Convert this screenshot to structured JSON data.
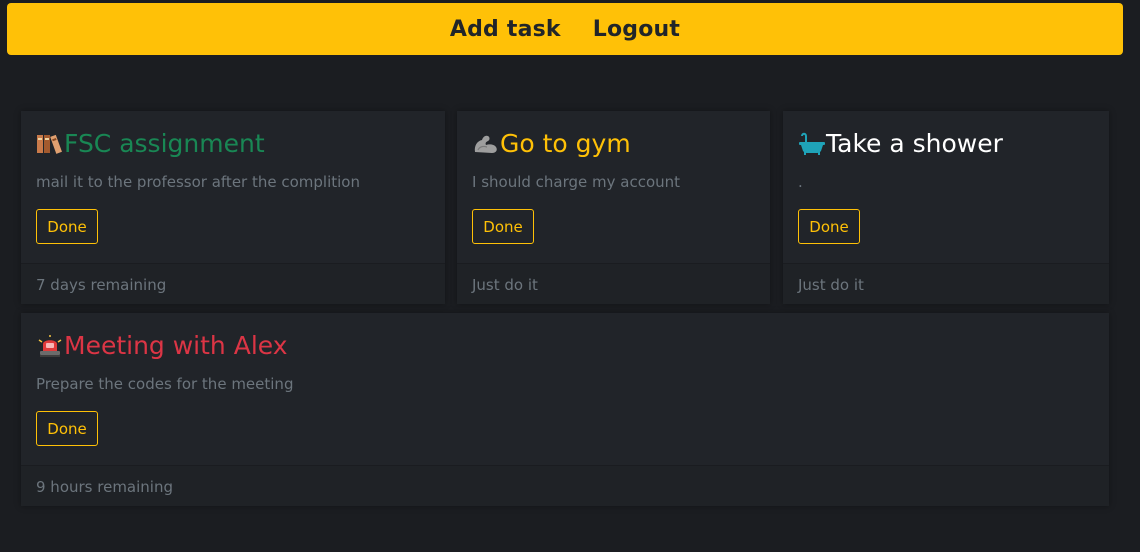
{
  "nav": {
    "add_task": "Add task",
    "logout": "Logout"
  },
  "colors": {
    "navbar": "#ffc107",
    "success": "#198754",
    "warning": "#ffc107",
    "light": "#ffffff",
    "danger": "#dc3545",
    "muted": "#6c757d",
    "background": "#1b1d21"
  },
  "tasks": [
    {
      "icon": "books-icon",
      "title": "FSC assignment",
      "description": "mail it to the professor after the complition",
      "button_label": "Done",
      "footer": "7 days remaining",
      "title_color": "#198754"
    },
    {
      "icon": "flexed-biceps-icon",
      "title": "Go to gym",
      "description": "I should charge my account",
      "button_label": "Done",
      "footer": "Just do it",
      "title_color": "#ffc107"
    },
    {
      "icon": "bathtub-icon",
      "title": "Take a shower",
      "description": ".",
      "button_label": "Done",
      "footer": "Just do it",
      "title_color": "#ffffff"
    },
    {
      "icon": "police-light-icon",
      "title": "Meeting with Alex",
      "description": "Prepare the codes for the meeting",
      "button_label": "Done",
      "footer": "9 hours remaining",
      "title_color": "#dc3545"
    }
  ]
}
